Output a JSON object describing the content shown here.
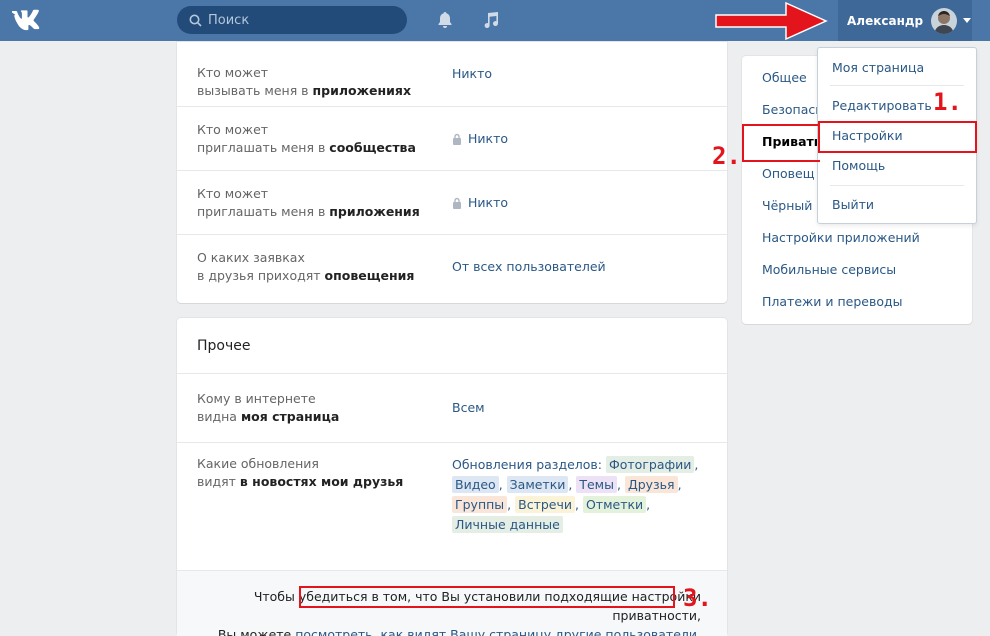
{
  "topbar": {
    "search_placeholder": "Поиск",
    "user_name": "Александр",
    "colors": {
      "bar": "#4a76a8",
      "search": "#224b7a",
      "profile": "#3d6898"
    }
  },
  "privacy_top": {
    "rows": [
      {
        "label_plain": "Кто может",
        "label_rest": "вызывать меня в ",
        "label_bold": "приложениях",
        "value": "Никто",
        "locked": false
      },
      {
        "label_plain": "Кто может",
        "label_rest": "приглашать меня в ",
        "label_bold": "сообщества",
        "value": "Никто",
        "locked": true
      },
      {
        "label_plain": "Кто может",
        "label_rest": "приглашать меня в ",
        "label_bold": "приложения",
        "value": "Никто",
        "locked": true
      },
      {
        "label_plain": "О каких заявках",
        "label_rest": "в друзья приходят ",
        "label_bold": "оповещения",
        "value": "От всех пользователей",
        "locked": false
      }
    ]
  },
  "other": {
    "title": "Прочее",
    "row1": {
      "label_plain": "Кому в интернете",
      "label_rest": "видна ",
      "label_bold": "моя страница",
      "value": "Всем"
    },
    "row2": {
      "label_plain": "Какие обновления",
      "label_rest": "видят ",
      "label_bold": "в новостях мои друзья",
      "prefix": "Обновления разделов:",
      "tags": [
        "Фотографии",
        "Видео",
        "Заметки",
        "Темы",
        "Друзья",
        "Группы",
        "Встречи",
        "Отметки",
        "Личные данные"
      ]
    },
    "note_line1": "Чтобы убедиться в том, что Вы установили подходящие настройки приватности,",
    "note_line2_prefix": "Вы можете ",
    "note_link": "посмотреть, как видят Вашу страницу другие пользователи",
    "note_line2_suffix": "."
  },
  "side_menu": {
    "items": [
      "Общее",
      "Безопасность",
      "Приватность",
      "Оповещения",
      "Чёрный список",
      "Настройки приложений",
      "Мобильные сервисы",
      "Платежи и переводы"
    ],
    "visible": [
      "Общее",
      "Безопасн",
      "Приватн",
      "Оповещ",
      "Чёрный с",
      "Настройки приложений",
      "Мобильные сервисы",
      "Платежи и переводы"
    ],
    "active_index": 2
  },
  "dropdown": {
    "items": [
      "Моя страница",
      "Редактировать",
      "Настройки",
      "Помощь",
      "Выйти"
    ]
  },
  "annotations": {
    "n1": "1.",
    "n2": "2.",
    "n3": "3.",
    "color": "#e3141c"
  }
}
